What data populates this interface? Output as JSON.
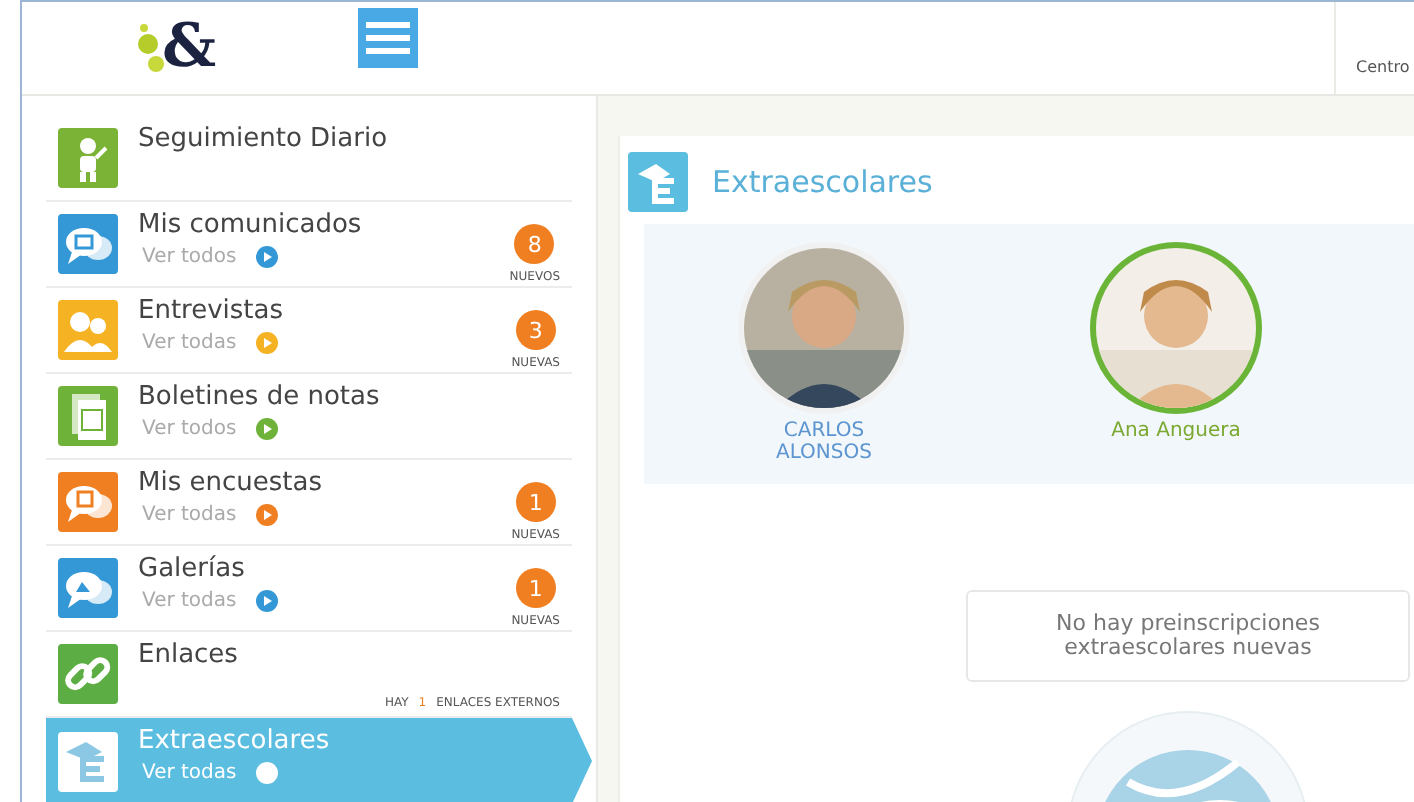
{
  "header": {
    "logo": "&",
    "user_label": "Centro"
  },
  "sidebar": {
    "items": [
      {
        "title": "Seguimiento Diario",
        "kind": "person",
        "color": "#7ab335",
        "selected": false
      },
      {
        "title": "Mis comunicados",
        "kind": "chat",
        "color": "#3598d6",
        "link": "Ver todos",
        "badge": "8",
        "badge_label": "NUEVOS",
        "selected": false
      },
      {
        "title": "Entrevistas",
        "kind": "people",
        "color": "#f5b323",
        "link": "Ver todas",
        "badge": "3",
        "badge_label": "NUEVAS",
        "selected": false
      },
      {
        "title": "Boletines de notas",
        "kind": "document",
        "color": "#6fb23a",
        "link": "Ver todos",
        "selected": false
      },
      {
        "title": "Mis encuestas",
        "kind": "survey",
        "color": "#f07f22",
        "link": "Ver todas",
        "badge": "1",
        "badge_label": "NUEVAS",
        "selected": false
      },
      {
        "title": "Galerías",
        "kind": "gallery",
        "color": "#3598d6",
        "link": "Ver todas",
        "badge": "1",
        "badge_label": "NUEVAS",
        "selected": false
      },
      {
        "title": "Enlaces",
        "kind": "link",
        "color": "#5cae44",
        "note": {
          "before": "HAY",
          "count": "1",
          "after": "ENLACES EXTERNOS"
        },
        "selected": false
      },
      {
        "title": "Extraescolares",
        "kind": "school",
        "color": "#ffffff",
        "link": "Ver todas",
        "selected": true
      }
    ]
  },
  "panel": {
    "title": "Extraescolares",
    "students": [
      {
        "name": "CARLOS ALONSOS",
        "selected": false
      },
      {
        "name": "Ana Anguera",
        "selected": true
      }
    ],
    "empty_message": "No hay preinscripciones extraescolares nuevas"
  }
}
